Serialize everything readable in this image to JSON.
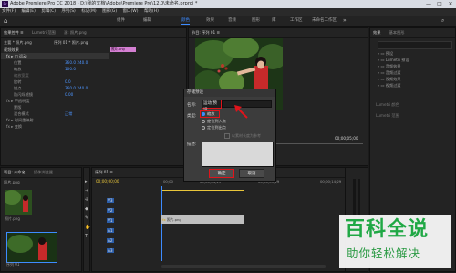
{
  "window": {
    "title": "Adobe Premiere Pro CC 2018 - D:\\我的文档\\Adobe\\Premiere Pro\\12.0\\未命名.prproj *",
    "logo": "Pr",
    "controls": [
      "—",
      "□",
      "✕"
    ]
  },
  "menu": [
    "文件(F)",
    "编辑(E)",
    "剪辑(C)",
    "序列(S)",
    "标记(M)",
    "图形(G)",
    "窗口(W)",
    "帮助(H)"
  ],
  "workspace": {
    "tabs": [
      "组件",
      "编辑",
      "颜色",
      "效果",
      "音频",
      "图形",
      "库",
      "工作区",
      "未命名工作区"
    ],
    "active_index": 2
  },
  "effect_controls": {
    "tabs": [
      "效果控件 ≡",
      "Lumetri 范围",
      "源: 照片.png"
    ],
    "clip_label": "主要 * 照片.png",
    "seq_label": "序列 01 * 照片.png",
    "rows": [
      "视频效果",
      "fx ▸ □ 运动",
      "位置",
      "缩放",
      "缩放宽度",
      "旋转",
      "锚点",
      "防闪烁滤镜",
      "fx ▸ 不透明度",
      "蒙版",
      "混合模式",
      "fx ▸ 时间重映射",
      "fx ▸ 变换"
    ],
    "values": [
      "",
      "",
      "360.0  240.0",
      "100.0",
      "",
      "0.0",
      "360.0  240.0",
      "0.00",
      "",
      "",
      "正常",
      "",
      ""
    ],
    "clip_tag": "照片.png"
  },
  "program": {
    "tab": "节目: 序列 01 ≡",
    "timecode_left": "00;00;00;00",
    "fit": "适合",
    "timecode_right": "00;00;05;00"
  },
  "project": {
    "tabs": [
      "项目: 未命名",
      "媒体浏览器"
    ],
    "item_name": "照片.png",
    "thumb_labels": [
      "照片.png",
      "序列 01"
    ]
  },
  "timeline": {
    "tab": "序列 01 ≡",
    "timecode": "00;00;00;00",
    "ruler": [
      "00;00",
      "00;00;04;29",
      "00;00;09;29",
      "00;00;14;29"
    ],
    "tracks": [
      "V3",
      "V2",
      "V1",
      "A1",
      "A2",
      "A3"
    ],
    "clip_label": "照片.png"
  },
  "effects_panel": {
    "tabs": [
      "效果",
      "基本图形"
    ],
    "items": [
      "预设",
      "Lumetri 预设",
      "音频效果",
      "音频过渡",
      "视频效果",
      "视频过渡"
    ],
    "side_labels": [
      "Lumetri 颜色",
      "Lumetri 范围"
    ]
  },
  "dialog": {
    "title": "存储预设",
    "name_label": "名称:",
    "name_value": "运动 预设",
    "type_label": "类型:",
    "options": [
      "缩放",
      "定位到入点",
      "定位到出点"
    ],
    "selected_option": 0,
    "checkbox_label": "以素材长度为参考",
    "desc_label": "描述:",
    "ok_label": "确定",
    "cancel_label": "取消"
  },
  "watermark": {
    "title": "百科全说",
    "subtitle": "助你轻松解决"
  },
  "colors": {
    "accent": "#3d8bff",
    "clip_pink": "#d47fd2",
    "highlight_red": "#e0141b",
    "watermark_green": "#20a845"
  }
}
